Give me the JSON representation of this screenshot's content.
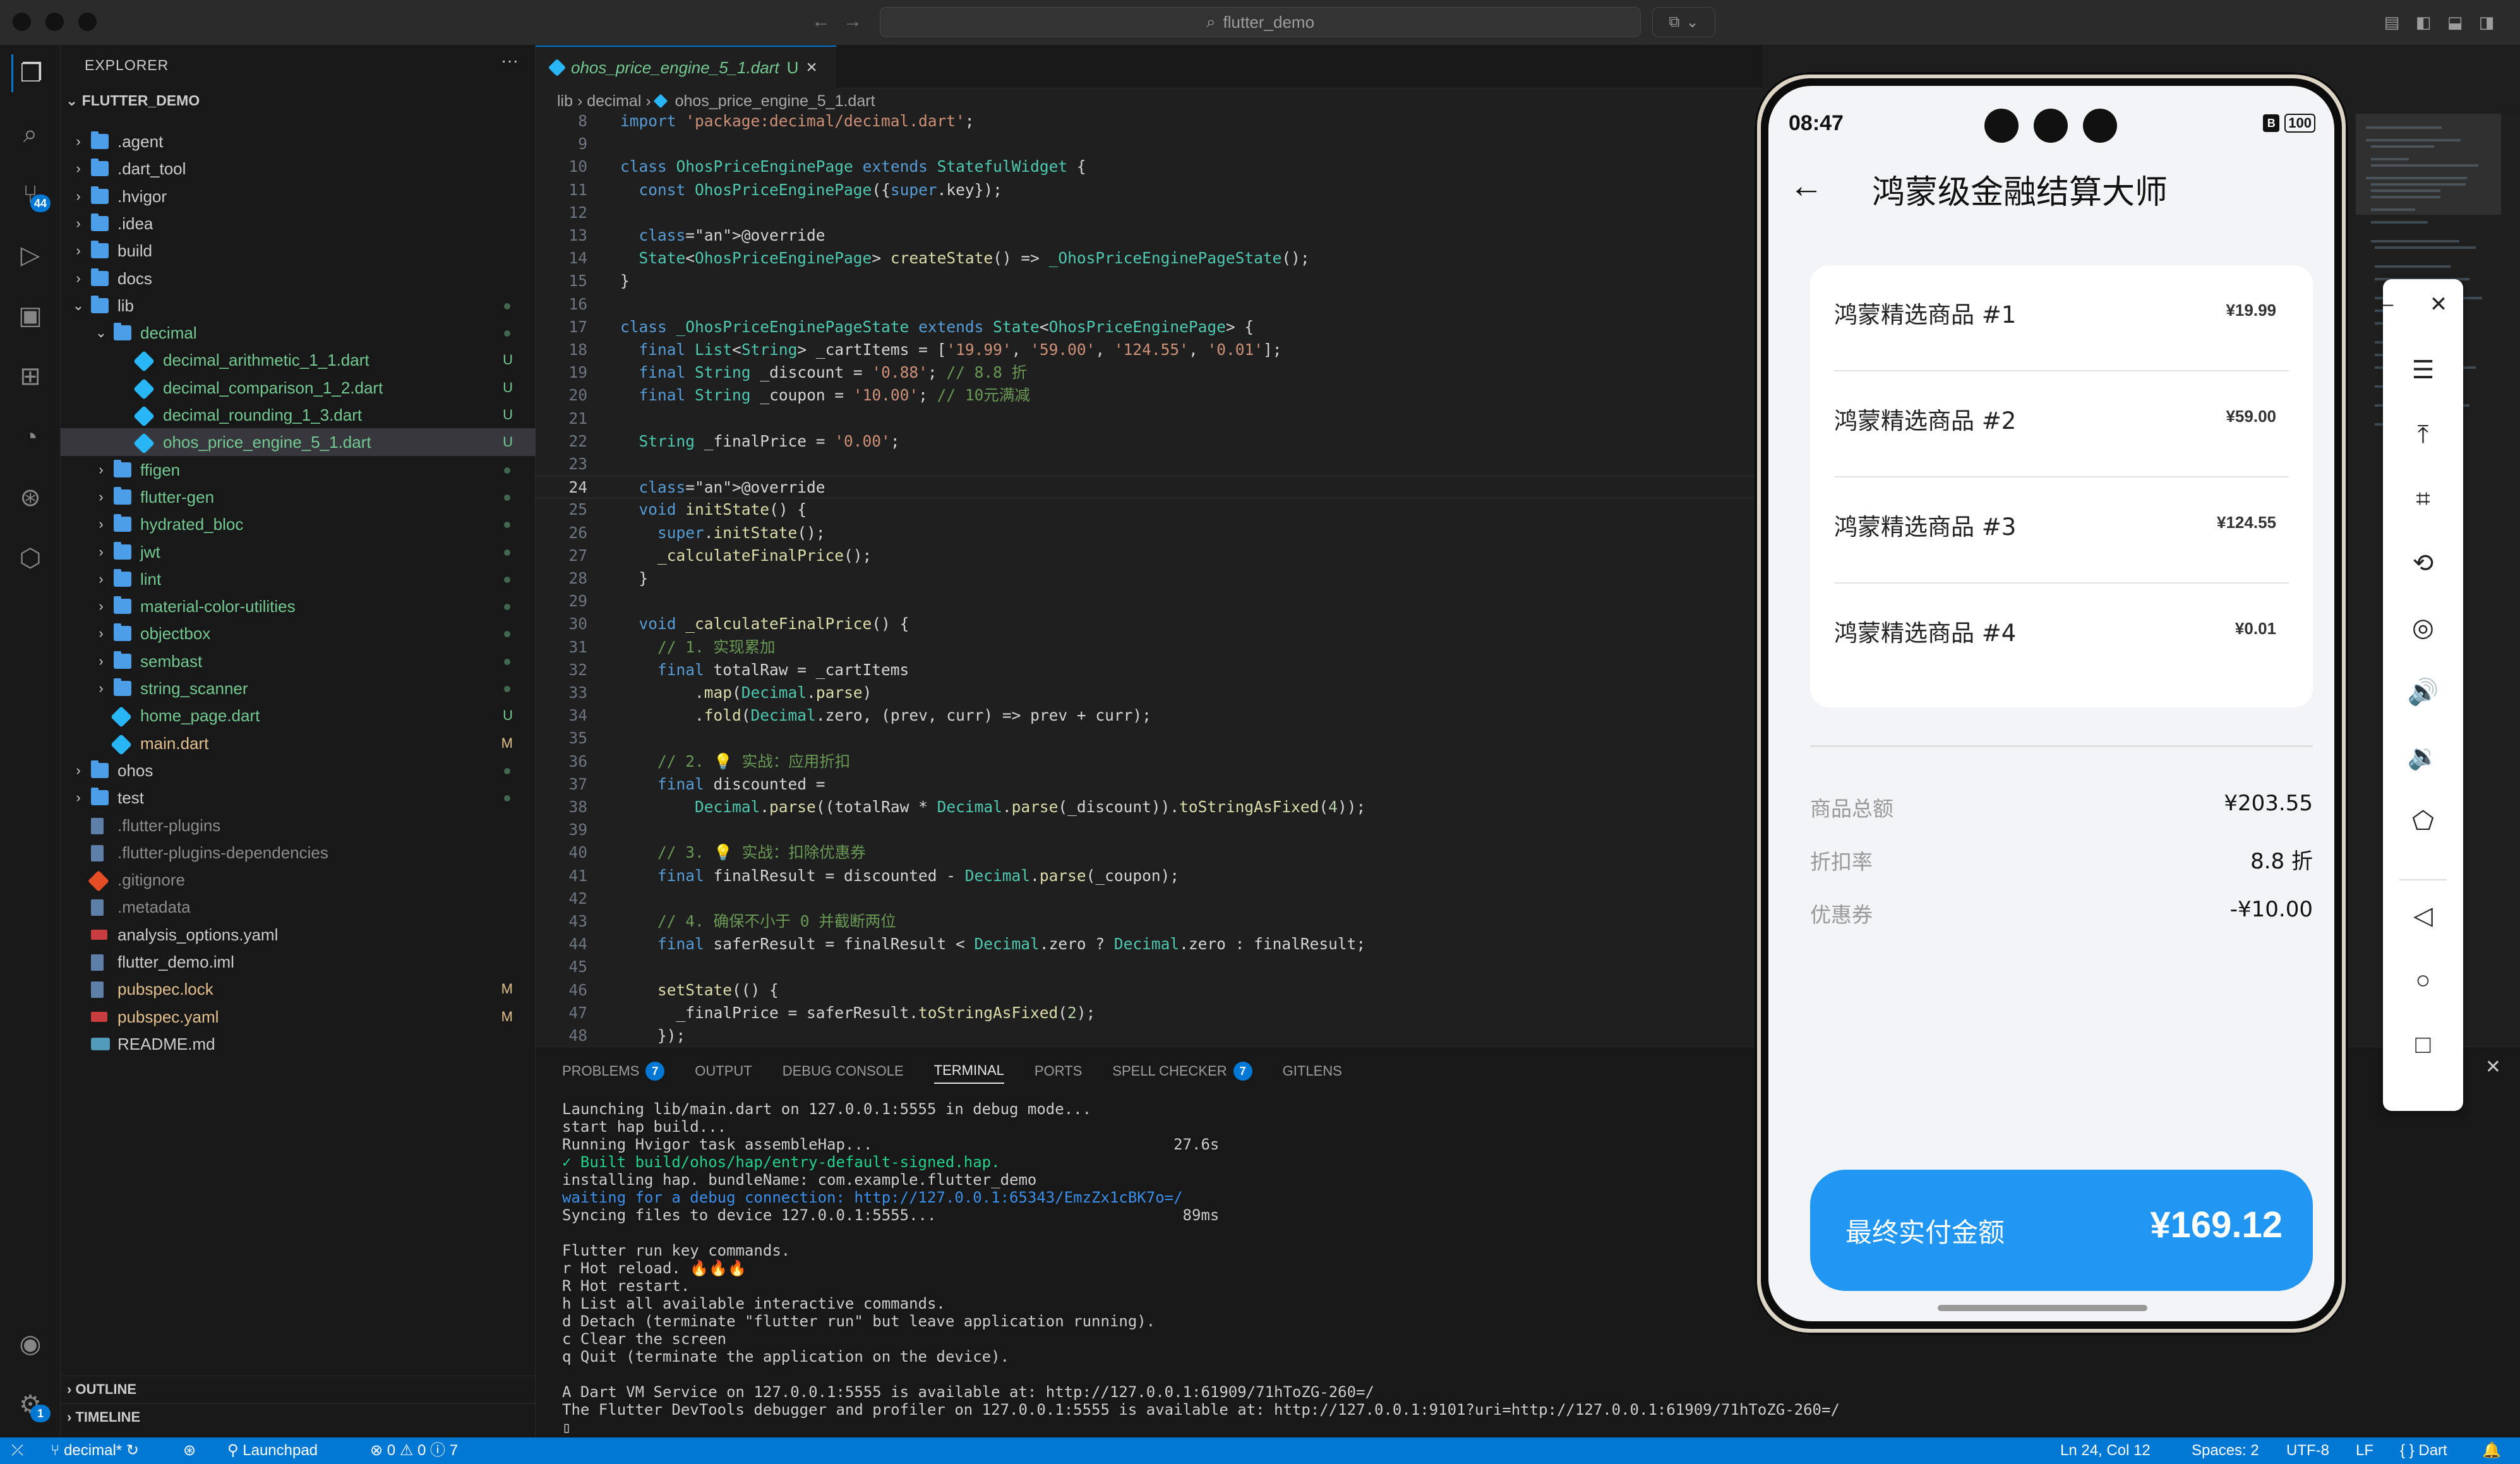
{
  "titlebar": {
    "search": "flutter_demo"
  },
  "activity_bar": {
    "scm_badge": "44",
    "settings_badge": "1"
  },
  "explorer": {
    "title": "EXPLORER",
    "more": "···",
    "root": "FLUTTER_DEMO",
    "items": [
      {
        "name": ".agent",
        "type": "folder",
        "chev": "›",
        "status": ""
      },
      {
        "name": ".dart_tool",
        "type": "folder",
        "chev": "›",
        "status": ""
      },
      {
        "name": ".hvigor",
        "type": "folder",
        "chev": "›",
        "status": ""
      },
      {
        "name": ".idea",
        "type": "folder",
        "chev": "›",
        "status": ""
      },
      {
        "name": "build",
        "type": "folder",
        "chev": "›",
        "status": ""
      },
      {
        "name": "docs",
        "type": "folder",
        "chev": "›",
        "status": ""
      },
      {
        "name": "lib",
        "type": "folder",
        "chev": "⌄",
        "status": ""
      },
      {
        "name": "decimal",
        "type": "folder",
        "chev": "⌄",
        "status": ""
      },
      {
        "name": "decimal_arithmetic_1_1.dart",
        "type": "dart",
        "chev": "",
        "status": "U"
      },
      {
        "name": "decimal_comparison_1_2.dart",
        "type": "dart",
        "chev": "",
        "status": "U"
      },
      {
        "name": "decimal_rounding_1_3.dart",
        "type": "dart",
        "chev": "",
        "status": "U"
      },
      {
        "name": "ohos_price_engine_5_1.dart",
        "type": "dart",
        "chev": "",
        "status": "U"
      },
      {
        "name": "ffigen",
        "type": "folder",
        "chev": "›",
        "status": ""
      },
      {
        "name": "flutter-gen",
        "type": "folder",
        "chev": "›",
        "status": ""
      },
      {
        "name": "hydrated_bloc",
        "type": "folder",
        "chev": "›",
        "status": ""
      },
      {
        "name": "jwt",
        "type": "folder",
        "chev": "›",
        "status": ""
      },
      {
        "name": "lint",
        "type": "folder",
        "chev": "›",
        "status": ""
      },
      {
        "name": "material-color-utilities",
        "type": "folder",
        "chev": "›",
        "status": ""
      },
      {
        "name": "objectbox",
        "type": "folder",
        "chev": "›",
        "status": ""
      },
      {
        "name": "sembast",
        "type": "folder",
        "chev": "›",
        "status": ""
      },
      {
        "name": "string_scanner",
        "type": "folder",
        "chev": "›",
        "status": ""
      },
      {
        "name": "home_page.dart",
        "type": "dart",
        "chev": "",
        "status": "U"
      },
      {
        "name": "main.dart",
        "type": "dart",
        "chev": "",
        "status": "M"
      },
      {
        "name": "ohos",
        "type": "folder",
        "chev": "›",
        "status": ""
      },
      {
        "name": "test",
        "type": "folder",
        "chev": "›",
        "status": ""
      },
      {
        "name": ".flutter-plugins",
        "type": "file",
        "chev": "",
        "status": ""
      },
      {
        "name": ".flutter-plugins-dependencies",
        "type": "file",
        "chev": "",
        "status": ""
      },
      {
        "name": ".gitignore",
        "type": "git",
        "chev": "",
        "status": ""
      },
      {
        "name": ".metadata",
        "type": "file",
        "chev": "",
        "status": ""
      },
      {
        "name": "analysis_options.yaml",
        "type": "yaml",
        "chev": "",
        "status": ""
      },
      {
        "name": "flutter_demo.iml",
        "type": "file",
        "chev": "",
        "status": ""
      },
      {
        "name": "pubspec.lock",
        "type": "file",
        "chev": "",
        "status": "M"
      },
      {
        "name": "pubspec.yaml",
        "type": "yaml",
        "chev": "",
        "status": "M"
      },
      {
        "name": "README.md",
        "type": "info",
        "chev": "",
        "status": ""
      }
    ],
    "outline": "OUTLINE",
    "timeline": "TIMELINE"
  },
  "editor": {
    "tab": {
      "label": "ohos_price_engine_5_1.dart",
      "status": "U",
      "close": "×"
    },
    "breadcrumb": [
      "lib",
      "decimal",
      "ohos_price_engine_5_1.dart"
    ],
    "current_line": 24,
    "lines": [
      {
        "n": 8,
        "code": "import 'package:decimal/decimal.dart';"
      },
      {
        "n": 9,
        "code": ""
      },
      {
        "n": 10,
        "code": "class OhosPriceEnginePage extends StatefulWidget {"
      },
      {
        "n": 11,
        "code": "  const OhosPriceEnginePage({super.key});"
      },
      {
        "n": 12,
        "code": ""
      },
      {
        "n": 13,
        "code": "  @override"
      },
      {
        "n": 14,
        "code": "  State<OhosPriceEnginePage> createState() => _OhosPriceEnginePageState();"
      },
      {
        "n": 15,
        "code": "}"
      },
      {
        "n": 16,
        "code": ""
      },
      {
        "n": 17,
        "code": "class _OhosPriceEnginePageState extends State<OhosPriceEnginePage> {"
      },
      {
        "n": 18,
        "code": "  final List<String> _cartItems = ['19.99', '59.00', '124.55', '0.01'];"
      },
      {
        "n": 19,
        "code": "  final String _discount = '0.88'; // 8.8 折"
      },
      {
        "n": 20,
        "code": "  final String _coupon = '10.00'; // 10元满减"
      },
      {
        "n": 21,
        "code": ""
      },
      {
        "n": 22,
        "code": "  String _finalPrice = '0.00';"
      },
      {
        "n": 23,
        "code": ""
      },
      {
        "n": 24,
        "code": "  @override"
      },
      {
        "n": 25,
        "code": "  void initState() {"
      },
      {
        "n": 26,
        "code": "    super.initState();"
      },
      {
        "n": 27,
        "code": "    _calculateFinalPrice();"
      },
      {
        "n": 28,
        "code": "  }"
      },
      {
        "n": 29,
        "code": ""
      },
      {
        "n": 30,
        "code": "  void _calculateFinalPrice() {"
      },
      {
        "n": 31,
        "code": "    // 1. 实现累加"
      },
      {
        "n": 32,
        "code": "    final totalRaw = _cartItems"
      },
      {
        "n": 33,
        "code": "        .map(Decimal.parse)"
      },
      {
        "n": 34,
        "code": "        .fold(Decimal.zero, (prev, curr) => prev + curr);"
      },
      {
        "n": 35,
        "code": ""
      },
      {
        "n": 36,
        "code": "    // 2. 💡 实战：应用折扣"
      },
      {
        "n": 37,
        "code": "    final discounted ="
      },
      {
        "n": 38,
        "code": "        Decimal.parse((totalRaw * Decimal.parse(_discount)).toStringAsFixed(4));"
      },
      {
        "n": 39,
        "code": ""
      },
      {
        "n": 40,
        "code": "    // 3. 💡 实战：扣除优惠券"
      },
      {
        "n": 41,
        "code": "    final finalResult = discounted - Decimal.parse(_coupon);"
      },
      {
        "n": 42,
        "code": ""
      },
      {
        "n": 43,
        "code": "    // 4. 确保不小于 0 并截断两位"
      },
      {
        "n": 44,
        "code": "    final saferResult = finalResult < Decimal.zero ? Decimal.zero : finalResult;"
      },
      {
        "n": 45,
        "code": ""
      },
      {
        "n": 46,
        "code": "    setState(() {"
      },
      {
        "n": 47,
        "code": "      _finalPrice = saferResult.toStringAsFixed(2);"
      },
      {
        "n": 48,
        "code": "    });"
      }
    ]
  },
  "panel": {
    "tabs": [
      {
        "label": "PROBLEMS",
        "badge": "7"
      },
      {
        "label": "OUTPUT",
        "badge": ""
      },
      {
        "label": "DEBUG CONSOLE",
        "badge": ""
      },
      {
        "label": "TERMINAL",
        "badge": ""
      },
      {
        "label": "PORTS",
        "badge": ""
      },
      {
        "label": "SPELL CHECKER",
        "badge": "7"
      },
      {
        "label": "GITLENS",
        "badge": ""
      }
    ],
    "active_tab": "TERMINAL",
    "terminal": [
      {
        "t": "Launching lib/main.dart on 127.0.0.1:5555 in debug mode...",
        "c": ""
      },
      {
        "t": "start hap build...",
        "c": ""
      },
      {
        "t": "Running Hvigor task assembleHap...                                 27.6s",
        "c": ""
      },
      {
        "t": "✓ Built build/ohos/hap/entry-default-signed.hap.",
        "c": "green"
      },
      {
        "t": "installing hap. bundleName: com.example.flutter_demo",
        "c": ""
      },
      {
        "t": "waiting for a debug connection: http://127.0.0.1:65343/EmzZx1cBK7o=/",
        "c": "blue"
      },
      {
        "t": "Syncing files to device 127.0.0.1:5555...                           89ms",
        "c": ""
      },
      {
        "t": "",
        "c": ""
      },
      {
        "t": "Flutter run key commands.",
        "c": ""
      },
      {
        "t": "r Hot reload. 🔥🔥🔥",
        "c": ""
      },
      {
        "t": "R Hot restart.",
        "c": ""
      },
      {
        "t": "h List all available interactive commands.",
        "c": ""
      },
      {
        "t": "d Detach (terminate \"flutter run\" but leave application running).",
        "c": ""
      },
      {
        "t": "c Clear the screen",
        "c": ""
      },
      {
        "t": "q Quit (terminate the application on the device).",
        "c": ""
      },
      {
        "t": "",
        "c": ""
      },
      {
        "t": "A Dart VM Service on 127.0.0.1:5555 is available at: http://127.0.0.1:61909/71hToZG-260=/",
        "c": ""
      },
      {
        "t": "The Flutter DevTools debugger and profiler on 127.0.0.1:5555 is available at: http://127.0.0.1:9101?uri=http://127.0.0.1:61909/71hToZG-260=/",
        "c": ""
      },
      {
        "t": "▯",
        "c": ""
      }
    ]
  },
  "statusbar": {
    "branch": "decimal*",
    "launchpad": "Launchpad",
    "errors": "0",
    "warnings": "0",
    "info": "7",
    "position": "Ln 24, Col 12",
    "spaces": "Spaces: 2",
    "encoding": "UTF-8",
    "eol": "LF",
    "language": "{ } Dart"
  },
  "phone": {
    "time": "08:47",
    "battery": "100",
    "sim": "B",
    "back": "←",
    "title": "鸿蒙级金融结算大师",
    "items": [
      {
        "name": "鸿蒙精选商品 #1",
        "price": "¥19.99"
      },
      {
        "name": "鸿蒙精选商品 #2",
        "price": "¥59.00"
      },
      {
        "name": "鸿蒙精选商品 #3",
        "price": "¥124.55"
      },
      {
        "name": "鸿蒙精选商品 #4",
        "price": "¥0.01"
      }
    ],
    "summary": [
      {
        "label": "商品总额",
        "value": "¥203.55"
      },
      {
        "label": "折扣率",
        "value": "8.8 折"
      },
      {
        "label": "优惠券",
        "value": "-¥10.00"
      }
    ],
    "final_label": "最终实付金额",
    "final_value": "¥169.12",
    "accent": "#2196f3"
  },
  "emulator_tools": [
    "minimize-icon",
    "close-icon",
    "menu-icon",
    "pin-top-icon",
    "crop-icon",
    "rotate-icon",
    "screenshot-icon",
    "volume-up-icon",
    "volume-down-icon",
    "shake-icon",
    "back-nav-icon",
    "home-nav-icon",
    "recents-nav-icon"
  ]
}
